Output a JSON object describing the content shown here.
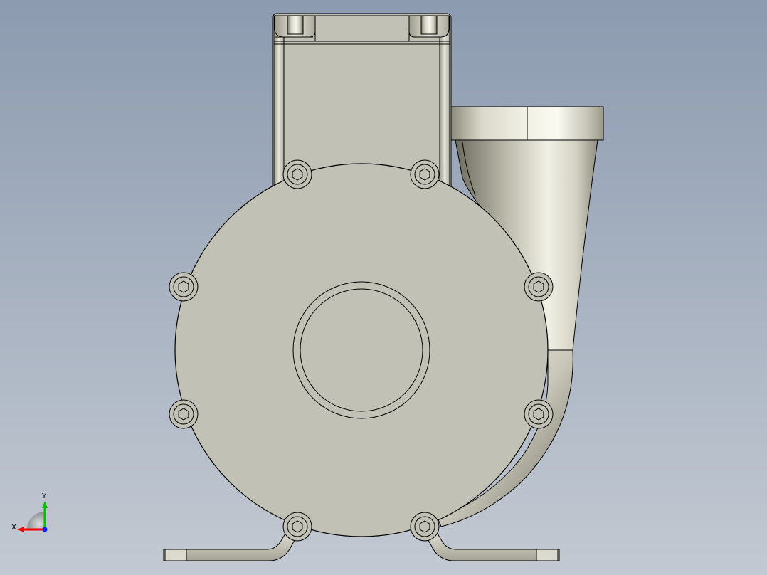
{
  "viewport": {
    "background_top": "#8c9bb0",
    "background_bottom": "#c3c9d2"
  },
  "model": {
    "metal_light": "#f4f3ea",
    "metal_mid": "#c8c7ba",
    "metal_dark": "#6f6e60",
    "face": "#c2c1b5",
    "edge": "#000000"
  },
  "triad": {
    "x_label": "X",
    "y_label": "Y",
    "x_color": "#ff0000",
    "y_color": "#00c000",
    "z_color": "#1020ff"
  }
}
